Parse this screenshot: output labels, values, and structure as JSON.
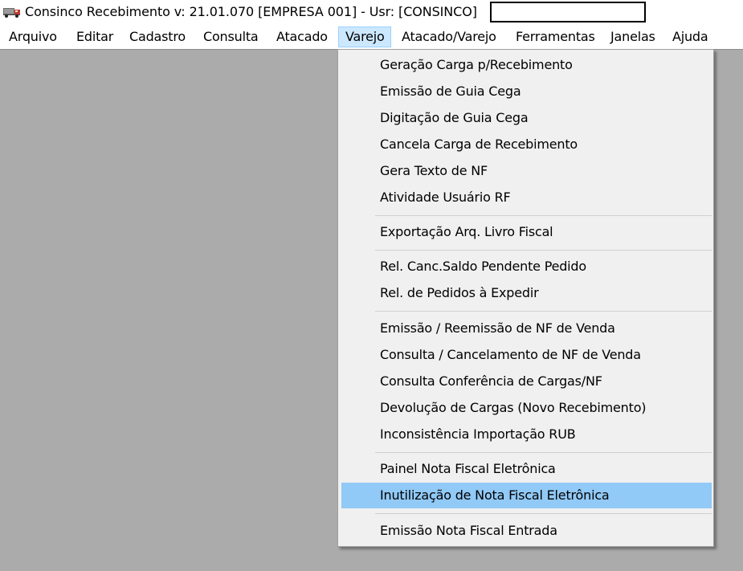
{
  "window": {
    "title": "Consinco Recebimento  v: 21.01.070   [EMPRESA 001] - Usr: [CONSINCO]",
    "app_icon": "truck-icon"
  },
  "menubar": {
    "items": [
      {
        "label": "Arquivo"
      },
      {
        "label": "Editar"
      },
      {
        "label": "Cadastro"
      },
      {
        "label": "Consulta"
      },
      {
        "label": "Atacado"
      },
      {
        "label": "Varejo",
        "active": true
      },
      {
        "label": "Atacado/Varejo"
      },
      {
        "label": "Ferramentas"
      },
      {
        "label": "Janelas"
      },
      {
        "label": "Ajuda"
      }
    ]
  },
  "dropdown": {
    "menu": "Varejo",
    "items": [
      {
        "label": "Geração Carga p/Recebimento"
      },
      {
        "label": "Emissão de Guia Cega"
      },
      {
        "label": "Digitação de Guia Cega"
      },
      {
        "label": "Cancela Carga de Recebimento"
      },
      {
        "label": "Gera Texto de NF"
      },
      {
        "label": "Atividade Usuário RF"
      },
      {
        "label": "Exportação Arq. Livro Fiscal"
      },
      {
        "label": "Rel. Canc.Saldo Pendente Pedido"
      },
      {
        "label": "Rel. de Pedidos à Expedir"
      },
      {
        "label": "Emissão / Reemissão de NF de Venda"
      },
      {
        "label": "Consulta / Cancelamento de NF de Venda"
      },
      {
        "label": "Consulta Conferência de Cargas/NF"
      },
      {
        "label": "Devolução de Cargas (Novo Recebimento)"
      },
      {
        "label": "Inconsistência Importação RUB"
      },
      {
        "label": "Painel Nota Fiscal Eletrônica"
      },
      {
        "label": "Inutilização de Nota Fiscal Eletrônica",
        "highlighted": true
      },
      {
        "label": "Emissão Nota Fiscal Entrada"
      }
    ]
  },
  "colors": {
    "workspace": "#ababab",
    "menu_background": "#f0f0f0",
    "menu_highlight": "#91c9f7",
    "menubar_active": "#cce8ff"
  }
}
